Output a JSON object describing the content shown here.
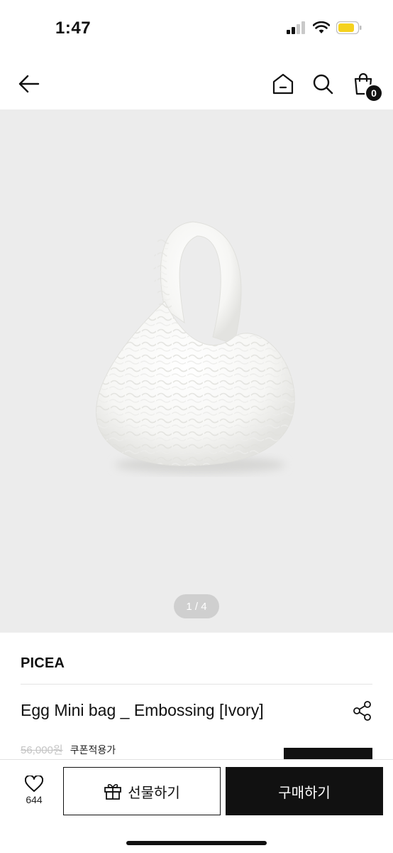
{
  "status_bar": {
    "time": "1:47"
  },
  "nav": {
    "back_icon": "arrow-left-icon",
    "home_icon": "home-icon",
    "search_icon": "search-icon",
    "cart_icon": "shopping-bag-icon",
    "cart_count": "0"
  },
  "gallery": {
    "image_alt": "Egg Mini bag",
    "pager": "1 / 4"
  },
  "product": {
    "brand": "PICEA",
    "title": "Egg Mini bag _ Embossing [Ivory]",
    "original_price": "56,000원",
    "coupon_label": "쿠폰적용가"
  },
  "bottom_bar": {
    "like_count": "644",
    "gift_label": "선물하기",
    "buy_label": "구매하기"
  },
  "colors": {
    "accent": "#111111",
    "gallery_bg": "#ececec",
    "battery": "#f5d21f"
  }
}
